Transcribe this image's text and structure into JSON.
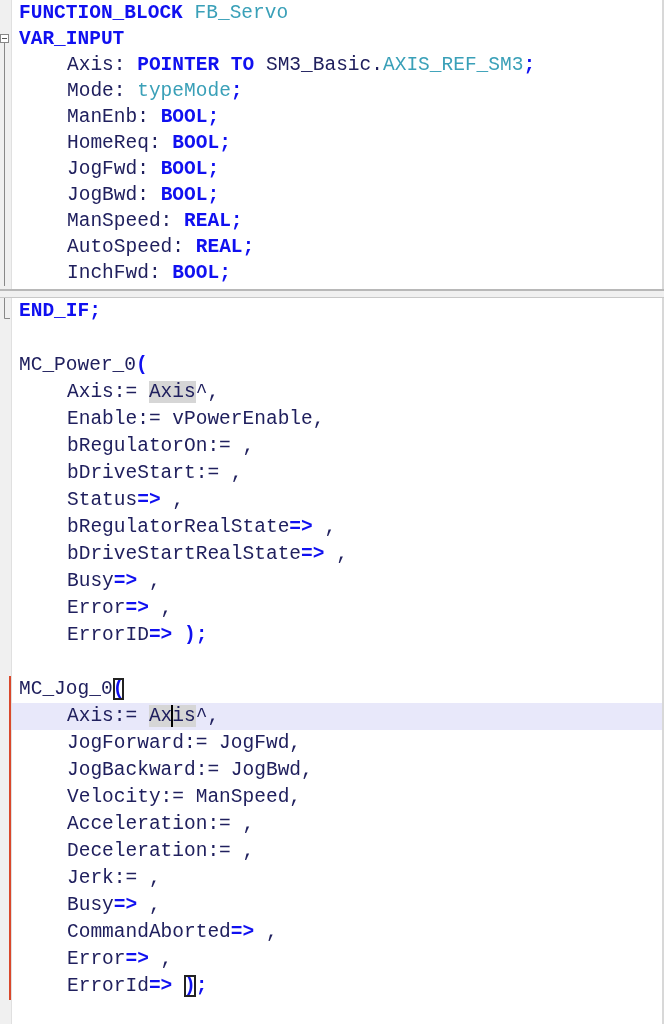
{
  "declaration_pane": {
    "lines": [
      {
        "tokens": [
          {
            "text": "FUNCTION_BLOCK ",
            "kind": "keyword"
          },
          {
            "text": "FB_Servo",
            "kind": "type"
          }
        ]
      },
      {
        "fold_start": true,
        "tokens": [
          {
            "text": "VAR_INPUT",
            "kind": "keyword"
          }
        ]
      },
      {
        "fold_guide": true,
        "indent": true,
        "tokens": [
          {
            "text": "Axis: ",
            "kind": "plain"
          },
          {
            "text": "POINTER TO",
            "kind": "keyword"
          },
          {
            "text": " SM3_Basic.",
            "kind": "plain"
          },
          {
            "text": "AXIS_REF_SM3",
            "kind": "type"
          },
          {
            "text": ";",
            "kind": "keyword"
          }
        ]
      },
      {
        "fold_guide": true,
        "indent": true,
        "tokens": [
          {
            "text": "Mode: ",
            "kind": "plain"
          },
          {
            "text": "typeMode",
            "kind": "type"
          },
          {
            "text": ";",
            "kind": "keyword"
          }
        ]
      },
      {
        "fold_guide": true,
        "indent": true,
        "tokens": [
          {
            "text": "ManEnb: ",
            "kind": "plain"
          },
          {
            "text": "BOOL;",
            "kind": "keyword"
          }
        ]
      },
      {
        "fold_guide": true,
        "indent": true,
        "tokens": [
          {
            "text": "HomeReq: ",
            "kind": "plain"
          },
          {
            "text": "BOOL;",
            "kind": "keyword"
          }
        ]
      },
      {
        "fold_guide": true,
        "indent": true,
        "tokens": [
          {
            "text": "JogFwd: ",
            "kind": "plain"
          },
          {
            "text": "BOOL;",
            "kind": "keyword"
          }
        ]
      },
      {
        "fold_guide": true,
        "indent": true,
        "tokens": [
          {
            "text": "JogBwd: ",
            "kind": "plain"
          },
          {
            "text": "BOOL;",
            "kind": "keyword"
          }
        ]
      },
      {
        "fold_guide": true,
        "indent": true,
        "tokens": [
          {
            "text": "ManSpeed: ",
            "kind": "plain"
          },
          {
            "text": "REAL;",
            "kind": "keyword"
          }
        ]
      },
      {
        "fold_guide": true,
        "indent": true,
        "tokens": [
          {
            "text": "AutoSpeed: ",
            "kind": "plain"
          },
          {
            "text": "REAL;",
            "kind": "keyword"
          }
        ]
      },
      {
        "fold_guide": true,
        "indent": true,
        "tokens": [
          {
            "text": "InchFwd: ",
            "kind": "plain"
          },
          {
            "text": "BOOL;",
            "kind": "keyword"
          }
        ]
      }
    ]
  },
  "implementation_pane": {
    "lines": [
      {
        "fold_end": true,
        "tokens": [
          {
            "text": "END_IF;",
            "kind": "keyword"
          }
        ]
      },
      {
        "gap_before": true,
        "tokens": [
          {
            "text": "MC_Power_0",
            "kind": "plain"
          },
          {
            "text": "(",
            "kind": "keyword"
          }
        ]
      },
      {
        "indent": true,
        "tokens": [
          {
            "text": "Axis:= ",
            "kind": "plain"
          },
          {
            "text": "Axis",
            "kind": "match"
          },
          {
            "text": "^,",
            "kind": "plain"
          }
        ]
      },
      {
        "indent": true,
        "tokens": [
          {
            "text": "Enable:= vPowerEnable,",
            "kind": "plain"
          }
        ]
      },
      {
        "indent": true,
        "tokens": [
          {
            "text": "bRegulatorOn:= ,",
            "kind": "plain"
          }
        ]
      },
      {
        "indent": true,
        "tokens": [
          {
            "text": "bDriveStart:= ,",
            "kind": "plain"
          }
        ]
      },
      {
        "indent": true,
        "tokens": [
          {
            "text": "Status",
            "kind": "plain"
          },
          {
            "text": "=>",
            "kind": "keyword"
          },
          {
            "text": " ,",
            "kind": "plain"
          }
        ]
      },
      {
        "indent": true,
        "tokens": [
          {
            "text": "bRegulatorRealState",
            "kind": "plain"
          },
          {
            "text": "=>",
            "kind": "keyword"
          },
          {
            "text": " ,",
            "kind": "plain"
          }
        ]
      },
      {
        "indent": true,
        "tokens": [
          {
            "text": "bDriveStartRealState",
            "kind": "plain"
          },
          {
            "text": "=>",
            "kind": "keyword"
          },
          {
            "text": " ,",
            "kind": "plain"
          }
        ]
      },
      {
        "indent": true,
        "tokens": [
          {
            "text": "Busy",
            "kind": "plain"
          },
          {
            "text": "=>",
            "kind": "keyword"
          },
          {
            "text": " ,",
            "kind": "plain"
          }
        ]
      },
      {
        "indent": true,
        "tokens": [
          {
            "text": "Error",
            "kind": "plain"
          },
          {
            "text": "=>",
            "kind": "keyword"
          },
          {
            "text": " ,",
            "kind": "plain"
          }
        ]
      },
      {
        "indent": true,
        "tokens": [
          {
            "text": "ErrorID",
            "kind": "plain"
          },
          {
            "text": "=> );",
            "kind": "keyword"
          }
        ]
      },
      {
        "gap_before": true,
        "changed": true,
        "tokens": [
          {
            "text": "MC_Jog_0",
            "kind": "plain"
          },
          {
            "text": "(",
            "kind": "bracket"
          }
        ]
      },
      {
        "changed": true,
        "current": true,
        "indent": true,
        "tokens": [
          {
            "text": "Axis:= ",
            "kind": "plain"
          },
          {
            "text": "Ax",
            "kind": "match"
          },
          {
            "text": "is",
            "kind": "match",
            "caret_before": true
          },
          {
            "text": "^,",
            "kind": "plain"
          }
        ]
      },
      {
        "changed": true,
        "indent": true,
        "tokens": [
          {
            "text": "JogForward:= JogFwd,",
            "kind": "plain"
          }
        ]
      },
      {
        "changed": true,
        "indent": true,
        "tokens": [
          {
            "text": "JogBackward:= JogBwd,",
            "kind": "plain"
          }
        ]
      },
      {
        "changed": true,
        "indent": true,
        "tokens": [
          {
            "text": "Velocity:= ManSpeed,",
            "kind": "plain"
          }
        ]
      },
      {
        "changed": true,
        "indent": true,
        "tokens": [
          {
            "text": "Acceleration:= ,",
            "kind": "plain"
          }
        ]
      },
      {
        "changed": true,
        "indent": true,
        "tokens": [
          {
            "text": "Deceleration:= ,",
            "kind": "plain"
          }
        ]
      },
      {
        "changed": true,
        "indent": true,
        "tokens": [
          {
            "text": "Jerk:= ,",
            "kind": "plain"
          }
        ]
      },
      {
        "changed": true,
        "indent": true,
        "tokens": [
          {
            "text": "Busy",
            "kind": "plain"
          },
          {
            "text": "=>",
            "kind": "keyword"
          },
          {
            "text": " ,",
            "kind": "plain"
          }
        ]
      },
      {
        "changed": true,
        "indent": true,
        "tokens": [
          {
            "text": "CommandAborted",
            "kind": "plain"
          },
          {
            "text": "=>",
            "kind": "keyword"
          },
          {
            "text": " ,",
            "kind": "plain"
          }
        ]
      },
      {
        "changed": true,
        "indent": true,
        "tokens": [
          {
            "text": "Error",
            "kind": "plain"
          },
          {
            "text": "=>",
            "kind": "keyword"
          },
          {
            "text": " ,",
            "kind": "plain"
          }
        ]
      },
      {
        "changed": true,
        "indent": true,
        "tokens": [
          {
            "text": "ErrorId",
            "kind": "plain"
          },
          {
            "text": "=> ",
            "kind": "keyword"
          },
          {
            "text": ")",
            "kind": "bracket"
          },
          {
            "text": ";",
            "kind": "keyword"
          }
        ]
      }
    ]
  }
}
